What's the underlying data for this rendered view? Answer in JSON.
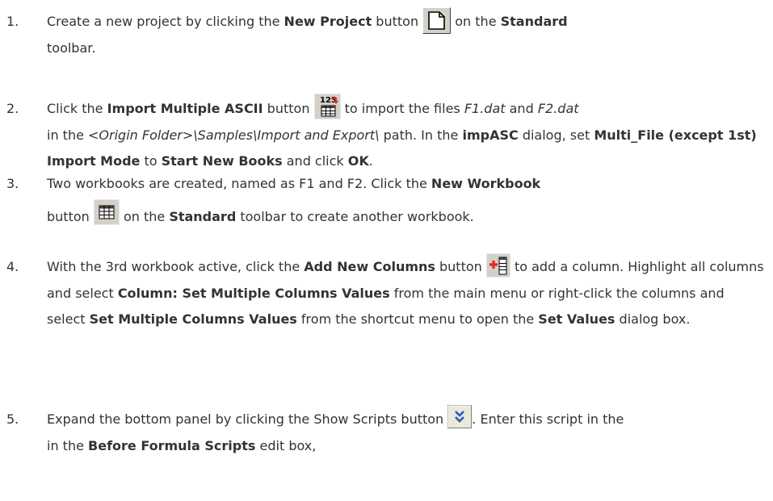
{
  "steps": [
    {
      "n": "1.",
      "a": "Create a new project by clicking the ",
      "b1": "New Project",
      "c": " button ",
      "icon": "new-project-icon",
      "d": " on the ",
      "b2": "Standard",
      "e": " toolbar."
    },
    {
      "n": "2.",
      "a": "Click the ",
      "b1": "Import Multiple ASCII",
      "c": " button ",
      "icon": "import-multiple-ascii-icon",
      "d": " to import the files ",
      "i1": "F1.dat",
      "e": " and ",
      "i2": "F2.dat",
      "f": " in the ",
      "i3": "<Origin Folder>\\Samples\\Import and Export\\",
      "g": " path. In the ",
      "b2": "impASC",
      "h": " dialog, set ",
      "b3": "Multi_File (except 1st) Import Mode",
      "j": " to ",
      "b4": "Start New Books",
      "k": " and click ",
      "b5": "OK",
      "l": "."
    },
    {
      "n": "3.",
      "a": "Two workbooks are created, named as F1 and F2. Click the ",
      "b1": "New Workbook",
      "c": "button ",
      "icon": "new-workbook-icon",
      "d": " on the ",
      "b2": "Standard",
      "e": " toolbar to create another workbook."
    },
    {
      "n": "4.",
      "a": "With the 3rd workbook active, click the ",
      "b1": "Add New Columns",
      "c": " button ",
      "icon": "add-new-columns-icon",
      "d": " to add a column. Highlight all columns and select ",
      "b2": "Column: Set Multiple Columns Values",
      "e": " from the main menu or right-click the columns and select ",
      "b3": "Set Multiple Columns Values",
      "f": " from the shortcut menu to open the ",
      "b4": "Set Values",
      "g": " dialog box."
    },
    {
      "n": "5.",
      "a": "Expand the bottom panel by clicking the Show Scripts button ",
      "icon": "show-scripts-icon",
      "b": ". Enter this script in the ",
      "b1": "Before Formula Scripts",
      "c": " edit box,"
    }
  ],
  "colors": {
    "text": "#333333",
    "icon_red": "#e8261a",
    "icon_blue": "#2c55c8",
    "button_face": "#d4d0c8"
  }
}
